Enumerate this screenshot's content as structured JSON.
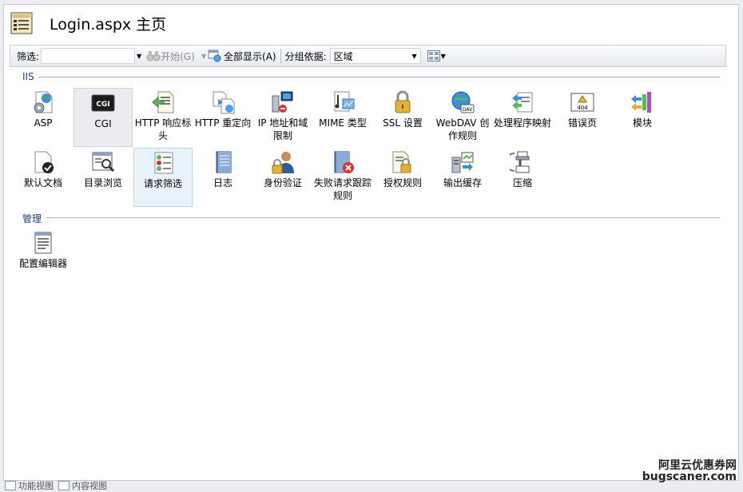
{
  "header": {
    "title": "Login.aspx 主页"
  },
  "toolbar": {
    "filter_label": "筛选:",
    "filter_value": "",
    "start_label": "开始(G)",
    "show_all_label": "全部显示(A)",
    "group_by_label": "分组依据:",
    "group_by_value": "区域"
  },
  "sections": [
    {
      "label": "IIS",
      "items": [
        {
          "label": "ASP",
          "icon": "asp-icon"
        },
        {
          "label": "CGI",
          "icon": "cgi-icon"
        },
        {
          "label": "HTTP 响应标头",
          "icon": "http-response-headers-icon"
        },
        {
          "label": "HTTP 重定向",
          "icon": "http-redirect-icon"
        },
        {
          "label": "IP 地址和域限制",
          "icon": "ip-domain-restrictions-icon"
        },
        {
          "label": "MIME 类型",
          "icon": "mime-types-icon"
        },
        {
          "label": "SSL 设置",
          "icon": "ssl-settings-icon"
        },
        {
          "label": "WebDAV 创作规则",
          "icon": "webdav-icon"
        },
        {
          "label": "处理程序映射",
          "icon": "handler-mappings-icon"
        },
        {
          "label": "错误页",
          "icon": "error-pages-icon"
        },
        {
          "label": "模块",
          "icon": "modules-icon"
        },
        {
          "label": "默认文档",
          "icon": "default-document-icon"
        },
        {
          "label": "目录浏览",
          "icon": "directory-browsing-icon"
        },
        {
          "label": "请求筛选",
          "icon": "request-filtering-icon"
        },
        {
          "label": "日志",
          "icon": "logging-icon"
        },
        {
          "label": "身份验证",
          "icon": "authentication-icon"
        },
        {
          "label": "失败请求跟踪规则",
          "icon": "failed-request-tracing-icon"
        },
        {
          "label": "授权规则",
          "icon": "authorization-rules-icon"
        },
        {
          "label": "输出缓存",
          "icon": "output-caching-icon"
        },
        {
          "label": "压缩",
          "icon": "compression-icon"
        }
      ]
    },
    {
      "label": "管理",
      "items": [
        {
          "label": "配置编辑器",
          "icon": "configuration-editor-icon"
        }
      ]
    }
  ],
  "bottom_tabs": [
    {
      "label": "功能视图"
    },
    {
      "label": "内容视图"
    }
  ],
  "watermark": {
    "line1": "阿里云优惠券网",
    "line2": "bugscaner.com"
  }
}
